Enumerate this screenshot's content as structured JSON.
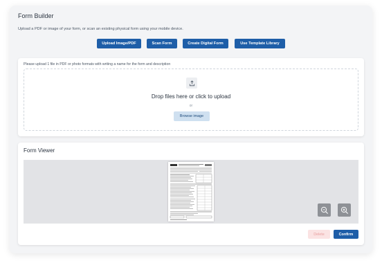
{
  "header": {
    "title": "Form Builder",
    "subtitle": "Upload a PDF or image of your form, or scan an existing physical form using your mobile device."
  },
  "toolbar": {
    "buttons": [
      {
        "label": "Upload Image/PDF"
      },
      {
        "label": "Scan Form"
      },
      {
        "label": "Create Digital Form"
      },
      {
        "label": "Use Template Library"
      }
    ]
  },
  "upload": {
    "hint": "Please upload 1 file in PDF or photo formats with writing a name for the form and description",
    "icon": "upload-icon",
    "drop_text": "Drop files here or click to upload",
    "or_text": "or",
    "browse_label": "Browse image"
  },
  "viewer": {
    "title": "Form Viewer",
    "zoom_out_icon": "zoom-out-icon",
    "zoom_in_icon": "zoom-in-icon",
    "delete_label": "Delete",
    "confirm_label": "Confirm"
  },
  "colors": {
    "primary": "#1e5ea8",
    "browse_bg": "#cfe0f0",
    "delete_bg": "#fbe3e3",
    "viewer_bg": "#e2e3e6"
  }
}
